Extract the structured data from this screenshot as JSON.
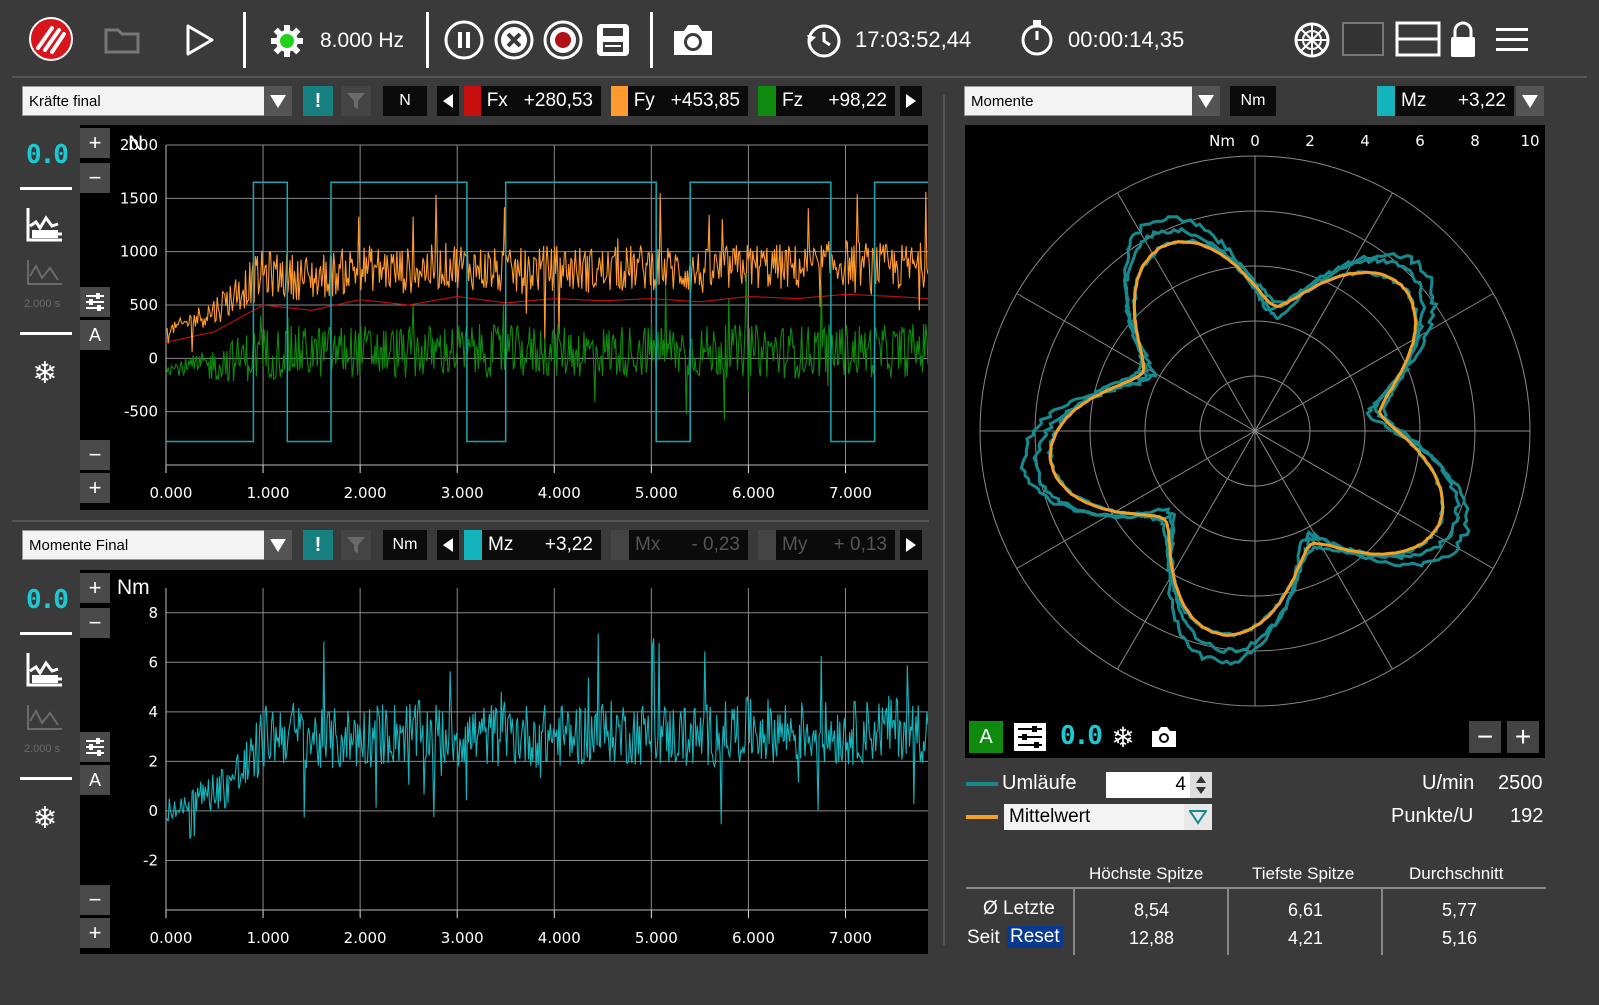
{
  "toolbar": {
    "frequency": "8.000 Hz",
    "clock": "17:03:52,44",
    "timer": "00:00:14,35"
  },
  "forces_panel": {
    "selector": "Kräfte final",
    "unit": "N",
    "axis_unit": "N",
    "channels": [
      {
        "name": "Fx",
        "value": "+280,53",
        "color": "#c81010"
      },
      {
        "name": "Fy",
        "value": "+453,85",
        "color": "#ff9a2e"
      },
      {
        "name": "Fz",
        "value": "+98,22",
        "color": "#0e8a0e"
      }
    ],
    "lcd": "0.0",
    "interval_label": "2.000 s",
    "auto_label": "A"
  },
  "moments_panel": {
    "selector": "Momente Final",
    "unit": "Nm",
    "axis_unit": "Nm",
    "channels": [
      {
        "name": "Mz",
        "value": "+3,22",
        "color": "#14b4bc"
      },
      {
        "name": "Mx",
        "value": "- 0,23",
        "color": "#444444"
      },
      {
        "name": "My",
        "value": "+ 0,13",
        "color": "#444444"
      }
    ],
    "lcd": "0.0",
    "interval_label": "2.000 s",
    "auto_label": "A"
  },
  "polar_panel": {
    "selector": "Momente",
    "unit": "Nm",
    "channel": {
      "name": "Mz",
      "value": "+3,22",
      "color": "#14b4bc"
    },
    "scale_unit": "Nm",
    "scale_ticks": [
      "0",
      "2",
      "4",
      "6",
      "8",
      "10"
    ],
    "auto_label": "A",
    "lcd": "0.0",
    "umlaeufe_label": "Umläufe",
    "umlaeufe_value": "4",
    "mode": "Mittelwert",
    "rpm_label": "U/min",
    "rpm_value": "2500",
    "points_label": "Punkte/U",
    "points_value": "192"
  },
  "stats": {
    "headers": [
      "Höchste Spitze",
      "Tiefste Spitze",
      "Durchschnitt"
    ],
    "rows": [
      {
        "label": "Ø Letzte",
        "values": [
          "8,54",
          "6,61",
          "5,77"
        ]
      },
      {
        "label_prefix": "Seit",
        "label_button": "Reset",
        "values": [
          "12,88",
          "4,21",
          "5,16"
        ]
      }
    ]
  },
  "chart_data": [
    {
      "type": "line",
      "xlabel": "",
      "ylabel": "N",
      "x_ticks": [
        "0.000",
        "1.000",
        "2.000",
        "3.000",
        "4.000",
        "5.000",
        "6.000",
        "7.000"
      ],
      "y_ticks": [
        "2000",
        "1500",
        "1000",
        "500",
        "0",
        "-500"
      ],
      "xlim": [
        0,
        7.85
      ],
      "ylim": [
        -1000,
        2000
      ],
      "grid": true,
      "series": [
        {
          "name": "Fx",
          "color": "#c81010",
          "x": [
            0,
            0.5,
            1.0,
            1.5,
            2.0,
            2.5,
            3.0,
            3.5,
            4.0,
            4.5,
            5.0,
            5.5,
            6.0,
            6.5,
            7.0,
            7.5,
            7.85
          ],
          "values": [
            150,
            250,
            500,
            450,
            550,
            500,
            580,
            520,
            560,
            540,
            560,
            530,
            580,
            560,
            600,
            580,
            560
          ]
        },
        {
          "name": "Fy",
          "color": "#ff9a2e",
          "x": [
            0,
            0.5,
            1.0,
            1.5,
            2.0,
            2.5,
            3.0,
            3.5,
            4.0,
            4.5,
            5.0,
            5.5,
            6.0,
            6.5,
            7.0,
            7.5,
            7.85
          ],
          "values": [
            250,
            450,
            800,
            750,
            850,
            820,
            880,
            800,
            850,
            820,
            860,
            800,
            870,
            850,
            900,
            850,
            880
          ]
        },
        {
          "name": "Fz",
          "color": "#0e8a0e",
          "x": [
            0,
            0.5,
            1.0,
            1.5,
            2.0,
            2.5,
            3.0,
            3.5,
            4.0,
            4.5,
            5.0,
            5.5,
            6.0,
            6.5,
            7.0,
            7.5,
            7.85
          ],
          "values": [
            -100,
            -60,
            50,
            60,
            70,
            50,
            80,
            60,
            70,
            60,
            80,
            60,
            70,
            60,
            80,
            60,
            100
          ]
        },
        {
          "name": "",
          "color": "#17a8b0",
          "x": [
            0,
            0.9,
            0.9,
            1.25,
            1.25,
            1.7,
            1.7,
            3.1,
            3.1,
            3.5,
            3.5,
            5.05,
            5.05,
            5.4,
            5.4,
            6.85,
            6.85,
            7.3,
            7.3,
            7.85
          ],
          "values": [
            -780,
            -780,
            1650,
            1650,
            -780,
            -780,
            1650,
            1650,
            -780,
            -780,
            1650,
            1650,
            -780,
            -780,
            1650,
            1650,
            -780,
            -780,
            1650,
            1650
          ]
        }
      ]
    },
    {
      "type": "line",
      "xlabel": "",
      "ylabel": "Nm",
      "x_ticks": [
        "0.000",
        "1.000",
        "2.000",
        "3.000",
        "4.000",
        "5.000",
        "6.000",
        "7.000"
      ],
      "y_ticks": [
        "8",
        "6",
        "4",
        "2",
        "0",
        "-2"
      ],
      "xlim": [
        0,
        7.85
      ],
      "ylim": [
        -4,
        9
      ],
      "grid": true,
      "series": [
        {
          "name": "Mz",
          "color": "#14b4bc",
          "x": [
            0,
            0.3,
            0.6,
            0.9,
            1.0,
            1.3,
            1.6,
            2.0,
            2.5,
            3.0,
            3.5,
            4.0,
            4.5,
            5.0,
            5.5,
            6.0,
            6.5,
            7.0,
            7.5,
            7.85
          ],
          "values": [
            -0.3,
            0.5,
            1.0,
            2.0,
            3.0,
            3.2,
            2.8,
            3.0,
            3.2,
            3.0,
            3.1,
            3.0,
            3.2,
            3.1,
            3.0,
            3.3,
            3.2,
            3.1,
            3.4,
            3.2
          ]
        }
      ]
    },
    {
      "type": "polar",
      "r_unit": "Nm",
      "r_ticks": [
        "0",
        "2",
        "4",
        "6",
        "8",
        "10"
      ],
      "rlim": [
        0,
        10
      ],
      "lobes": 5,
      "series": [
        {
          "name": "Umläufe",
          "color": "#168a8f",
          "r_min": 4.2,
          "r_max": 8.5
        },
        {
          "name": "Mittelwert",
          "color": "#f5a025",
          "r_min": 4.6,
          "r_max": 7.5
        }
      ]
    }
  ]
}
